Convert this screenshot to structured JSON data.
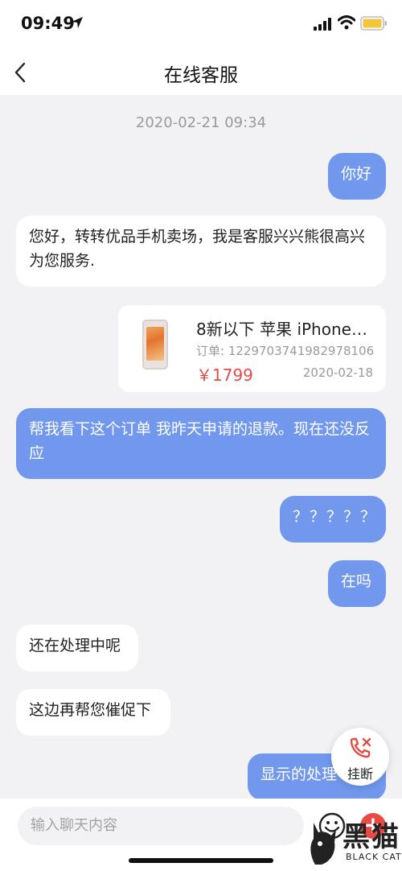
{
  "status_bar": {
    "time": "09:49"
  },
  "nav": {
    "title": "在线客服"
  },
  "chat": {
    "timestamp": "2020-02-21 09:34",
    "messages": [
      {
        "text": "你好"
      },
      {
        "text": "您好，转转优品手机卖场，我是客服兴兴熊很高兴为您服务."
      },
      {
        "text": "帮我看下这个订单 我昨天申请的退款。现在还没反应"
      },
      {
        "text": "？？？？？"
      },
      {
        "text": "在吗"
      },
      {
        "text": "还在处理中呢"
      },
      {
        "text": "这边再帮您催促下"
      },
      {
        "text": "显示的处理"
      }
    ],
    "product_card": {
      "name": "8新以下 苹果 iPhone…",
      "order": "订单: 1229703741982978106",
      "price": "￥1799",
      "date": "2020-02-18"
    }
  },
  "hangup": {
    "label": "挂断"
  },
  "input": {
    "placeholder": "输入聊天内容"
  },
  "watermark": {
    "cn": "黑猫",
    "en": "BLACK CAT"
  },
  "colors": {
    "outgoing_bubble": "#7298ee",
    "incoming_bubble": "#ffffff",
    "price": "#e34b45",
    "plus_button": "#e84a45"
  }
}
